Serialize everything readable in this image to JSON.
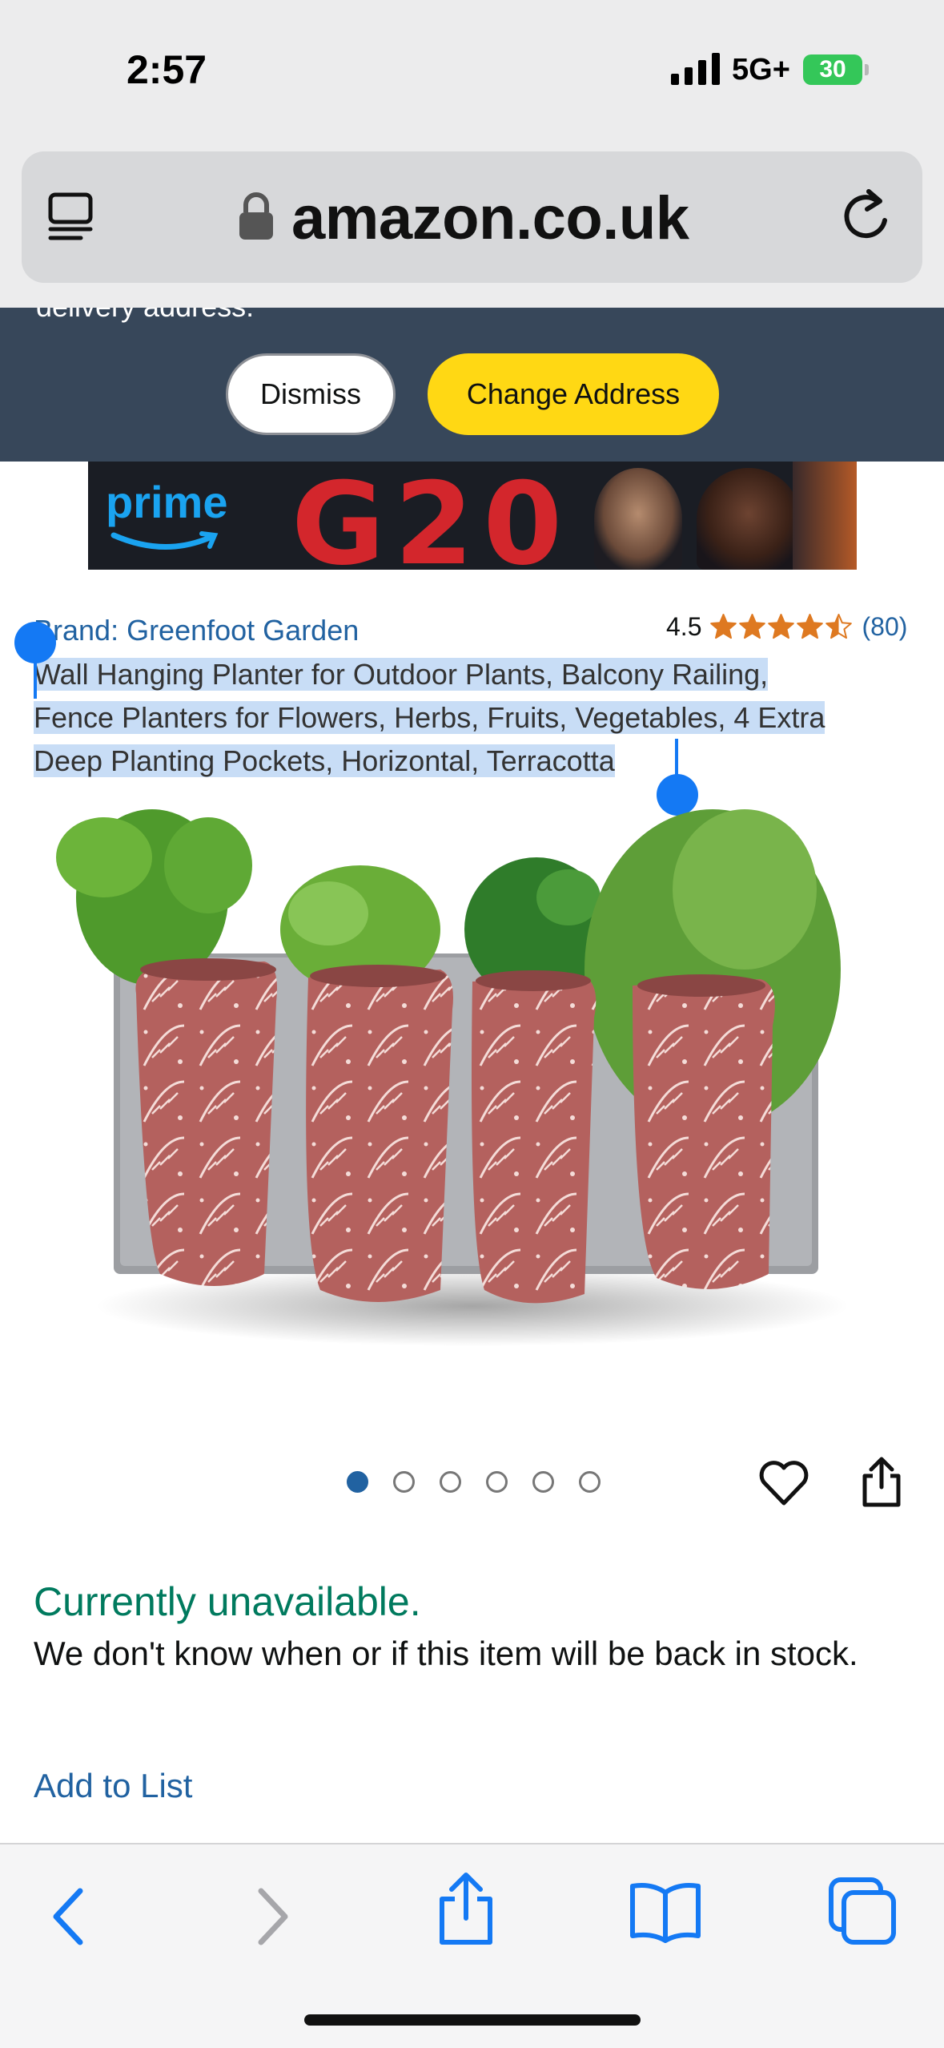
{
  "status_bar": {
    "time": "2:57",
    "network": "5G+",
    "battery": "30"
  },
  "browser": {
    "url": "amazon.co.uk"
  },
  "address_banner": {
    "partial_text": "delivery address.",
    "dismiss_label": "Dismiss",
    "change_label": "Change Address"
  },
  "ad": {
    "brand": "prime",
    "title": "G20"
  },
  "product": {
    "brand_link": "Brand: Greenfoot Garden",
    "rating": "4.5",
    "rating_value": 4.5,
    "rating_count": "(80)",
    "title_lines": [
      "Wall Hanging Planter for Outdoor Plants, Balcony Railing,",
      "Fence Planters for Flowers, Herbs, Fruits, Vegetables, 4 Extra",
      "Deep Planting Pockets, Horizontal, Terracotta"
    ],
    "image_dots": 6,
    "active_dot": 0
  },
  "availability": {
    "title": "Currently unavailable.",
    "text": "We don't know when or if this item will be back in stock.",
    "add_to_list": "Add to List"
  },
  "colors": {
    "link": "#2162a1",
    "unavailable": "#007a5e",
    "banner": "#37475a",
    "change_button": "#ffd814",
    "selection": "#c8ddf6",
    "safari_blue": "#1479f4"
  },
  "icons": {
    "reader": "reader-mode-icon",
    "lock": "lock-icon",
    "reload": "reload-icon",
    "heart": "heart-icon",
    "share": "share-icon",
    "back": "back-icon",
    "forward": "forward-icon",
    "bookmarks": "bookmarks-icon",
    "tabs": "tabs-icon"
  }
}
